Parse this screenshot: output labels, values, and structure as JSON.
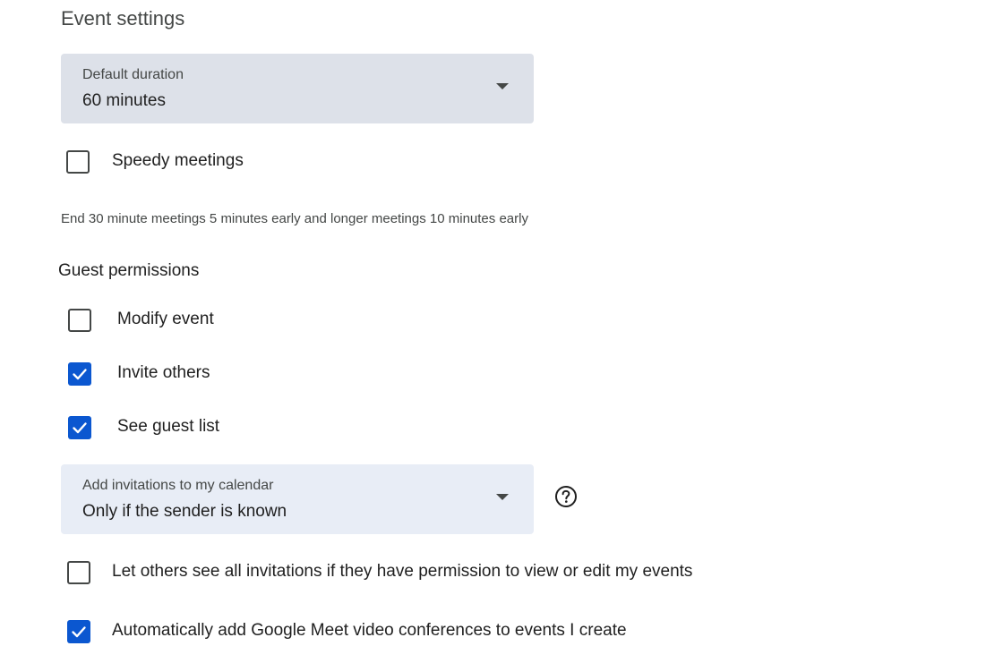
{
  "event_settings": {
    "title": "Event settings",
    "default_duration": {
      "label": "Default duration",
      "value": "60 minutes"
    },
    "speedy_meetings": {
      "label": "Speedy meetings",
      "checked": false
    },
    "speedy_help": "End 30 minute meetings 5 minutes early and longer meetings 10 minutes early",
    "guest_permissions": {
      "title": "Guest permissions",
      "options": [
        {
          "label": "Modify event",
          "checked": false
        },
        {
          "label": "Invite others",
          "checked": true
        },
        {
          "label": "See guest list",
          "checked": true
        }
      ]
    },
    "add_invitations": {
      "label": "Add invitations to my calendar",
      "value": "Only if the sender is known",
      "help_icon": "help-circle-icon"
    },
    "let_others_see": {
      "label": "Let others see all invitations if they have permission to view or edit my events",
      "checked": false
    },
    "auto_meet": {
      "label": "Automatically add Google Meet video conferences to events I create",
      "checked": true
    }
  },
  "colors": {
    "accent": "#0b57d0",
    "select_bg_active": "#dde1e9",
    "select_bg": "#e8edf6",
    "text_secondary": "#444746"
  }
}
